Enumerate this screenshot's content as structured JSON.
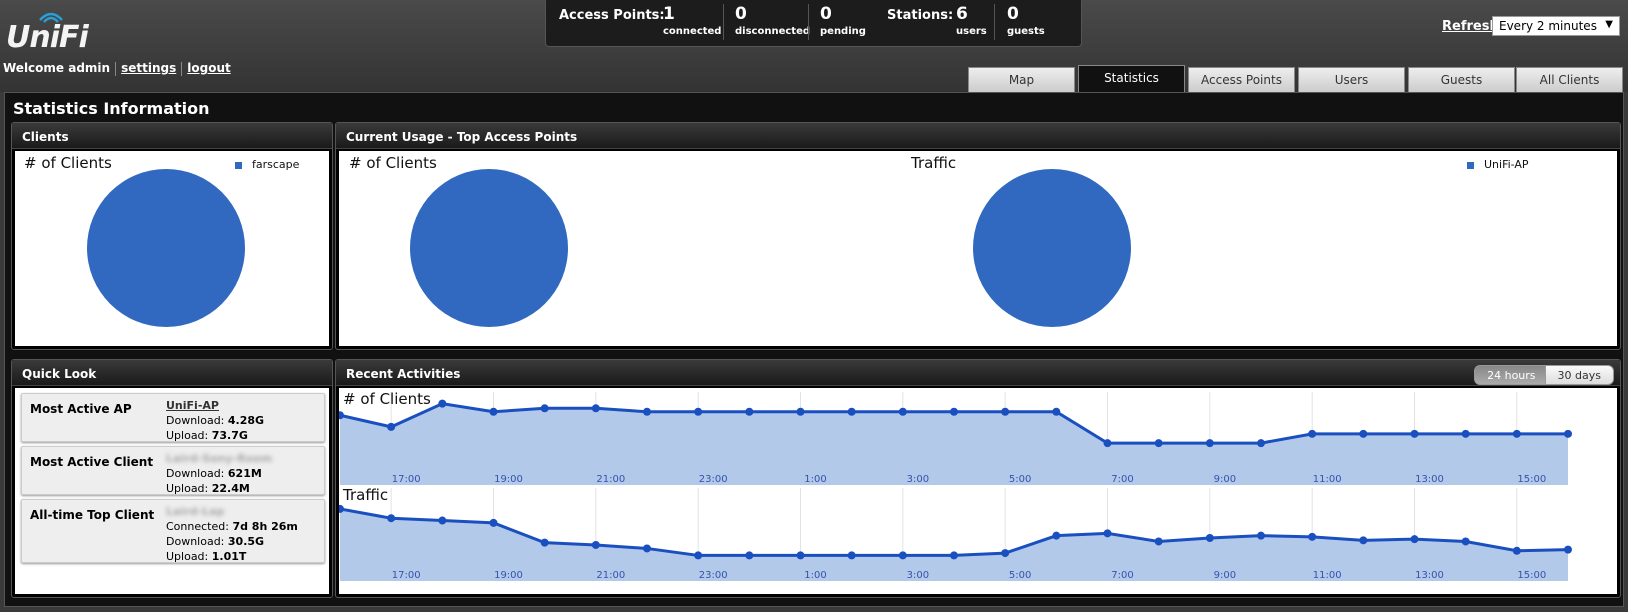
{
  "brand": {
    "name": "UniFi"
  },
  "user": {
    "welcome": "Welcome admin",
    "settings": "settings",
    "logout": "logout"
  },
  "summary": {
    "access_points_label": "Access Points:",
    "connected": {
      "value": "1",
      "label": "connected"
    },
    "disconnected": {
      "value": "0",
      "label": "disconnected"
    },
    "pending": {
      "value": "0",
      "label": "pending"
    },
    "stations_label": "Stations:",
    "users": {
      "value": "6",
      "label": "users"
    },
    "guests": {
      "value": "0",
      "label": "guests"
    }
  },
  "refresh": {
    "label": "Refresh",
    "selected": "Every 2 minutes"
  },
  "tabs": [
    "Map",
    "Statistics",
    "Access Points",
    "Users",
    "Guests",
    "All Clients"
  ],
  "active_tab": "Statistics",
  "page_title": "Statistics Information",
  "clients_panel": {
    "title": "Clients",
    "chart_title": "# of Clients",
    "legend": "farscape"
  },
  "usage_panel": {
    "title": "Current Usage - Top Access Points",
    "clients_chart_title": "# of Clients",
    "traffic_chart_title": "Traffic",
    "legend": "UniFi-AP"
  },
  "quick_look": {
    "title": "Quick Look",
    "most_active_ap": {
      "label": "Most Active AP",
      "name": "UniFi-AP",
      "download_label": "Download:",
      "download": "4.28G",
      "upload_label": "Upload:",
      "upload": "73.7G"
    },
    "most_active_client": {
      "label": "Most Active Client",
      "name": "Laird-Sony-Room",
      "download_label": "Download:",
      "download": "621M",
      "upload_label": "Upload:",
      "upload": "22.4M"
    },
    "alltime_top_client": {
      "label": "All-time Top Client",
      "name": "Laird-Lap",
      "connected_label": "Connected:",
      "connected": "7d 8h 26m",
      "download_label": "Download:",
      "download": "30.5G",
      "upload_label": "Upload:",
      "upload": "1.01T"
    }
  },
  "recent": {
    "title": "Recent Activities",
    "range_24": "24 hours",
    "range_30": "30 days",
    "clients_title": "# of Clients",
    "traffic_title": "Traffic"
  },
  "colors": {
    "series": "#1a4fc0",
    "fill": "#b3c9ea",
    "pie": "#3169c0"
  },
  "chart_data": [
    {
      "type": "pie",
      "title": "# of Clients",
      "categories": [
        "farscape"
      ],
      "values": [
        100
      ]
    },
    {
      "type": "pie",
      "title": "# of Clients",
      "categories": [
        "UniFi-AP"
      ],
      "values": [
        100
      ]
    },
    {
      "type": "pie",
      "title": "Traffic",
      "categories": [
        "UniFi-AP"
      ],
      "values": [
        100
      ]
    },
    {
      "type": "area",
      "title": "# of Clients",
      "x_ticks": [
        "17:00",
        "19:00",
        "21:00",
        "23:00",
        "1:00",
        "3:00",
        "5:00",
        "7:00",
        "9:00",
        "11:00",
        "13:00",
        "15:00"
      ],
      "series": [
        {
          "values": [
            6,
            5,
            7,
            6.3,
            6.6,
            6.6,
            6.3,
            6.3,
            6.3,
            6.3,
            6.3,
            6.3,
            6.3,
            6.3,
            6.3,
            3.6,
            3.6,
            3.6,
            3.6,
            4.4,
            4.4,
            4.4,
            4.4,
            4.4,
            4.4
          ]
        }
      ]
    },
    {
      "type": "area",
      "title": "Traffic",
      "x_ticks": [
        "17:00",
        "19:00",
        "21:00",
        "23:00",
        "1:00",
        "3:00",
        "5:00",
        "7:00",
        "9:00",
        "11:00",
        "13:00",
        "15:00"
      ],
      "series": [
        {
          "values": [
            6.2,
            5.4,
            5.2,
            5.0,
            3.3,
            3.1,
            2.8,
            2.2,
            2.2,
            2.2,
            2.2,
            2.2,
            2.2,
            2.4,
            3.9,
            4.1,
            3.4,
            3.7,
            3.9,
            3.8,
            3.5,
            3.6,
            3.4,
            2.6,
            2.7
          ]
        }
      ]
    }
  ]
}
